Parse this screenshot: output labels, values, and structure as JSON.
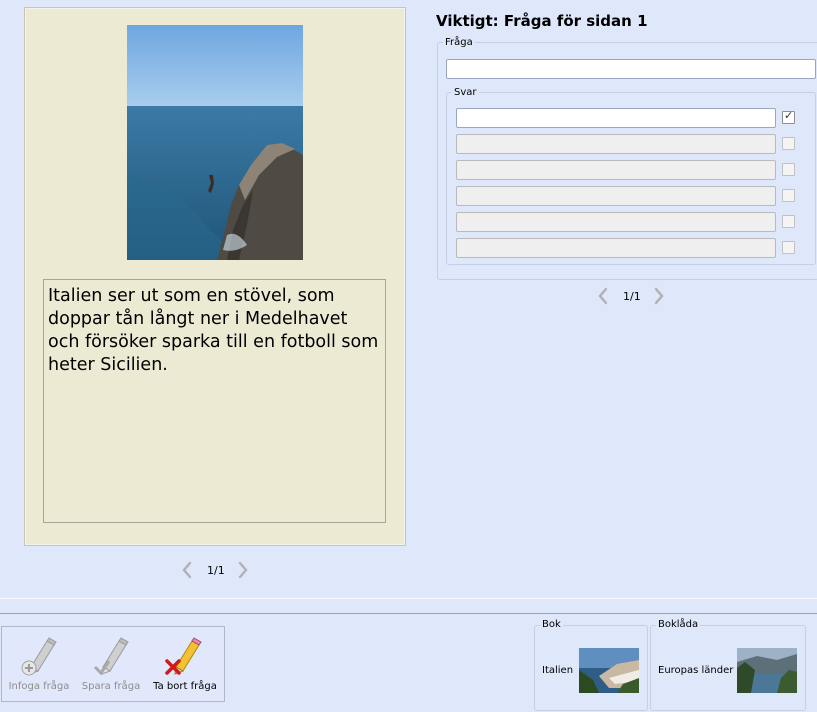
{
  "page_card": {
    "image_alt": "Italian coast photo",
    "text": "Italien ser ut som en stövel, som doppar tån långt ner i Medelhavet och försöker sparka till en fotboll som heter Sicilien.",
    "pager": "1/1"
  },
  "question": {
    "title": "Viktigt: Fråga för sidan 1",
    "fraga_legend": "Fråga",
    "fraga_value": "",
    "svar_legend": "Svar",
    "answers": [
      {
        "value": "",
        "enabled": true,
        "checked": true
      },
      {
        "value": "",
        "enabled": false,
        "checked": false
      },
      {
        "value": "",
        "enabled": false,
        "checked": false
      },
      {
        "value": "",
        "enabled": false,
        "checked": false
      },
      {
        "value": "",
        "enabled": false,
        "checked": false
      },
      {
        "value": "",
        "enabled": false,
        "checked": false
      }
    ],
    "pager": "1/1"
  },
  "toolbar": {
    "insert_label": "Infoga fråga",
    "save_label": "Spara fråga",
    "delete_label": "Ta bort fråga"
  },
  "bok": {
    "legend": "Bok",
    "name": "Italien"
  },
  "boklada": {
    "legend": "Boklåda",
    "name": "Europas länder"
  },
  "colors": {
    "background": "#dfe7fb",
    "card": "#ecead3",
    "sea": "#2f6a96",
    "sky": "#7fb0e2"
  }
}
